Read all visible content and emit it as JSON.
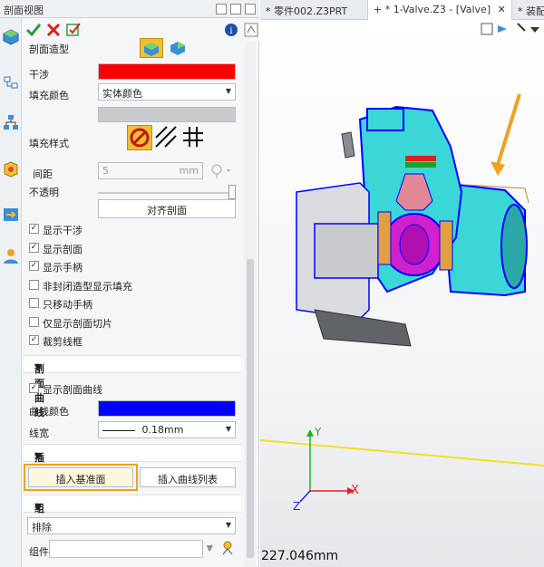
{
  "panel": {
    "title": "剖面视图",
    "section_shape_label": "剖面造型",
    "interference_label": "干涉",
    "interference_color": "#ff0000",
    "fill_color_label": "填充颜色",
    "fill_color_value": "实体颜色",
    "fill_style_label": "填充样式",
    "spacing_label": "间距",
    "spacing_value": "5",
    "spacing_unit": "mm",
    "opacity_label": "不透明",
    "align_button": "对齐剖面",
    "checkboxes": [
      {
        "label": "显示干涉",
        "checked": true
      },
      {
        "label": "显示剖面",
        "checked": true
      },
      {
        "label": "显示手柄",
        "checked": true
      },
      {
        "label": "非封闭造型显示填充",
        "checked": false
      },
      {
        "label": "只移动手柄",
        "checked": false
      },
      {
        "label": "仅显示剖面切片",
        "checked": false
      },
      {
        "label": "裁剪线框",
        "checked": true
      }
    ],
    "curve_section": {
      "title": "剖面曲线",
      "show_curve_label": "显示剖面曲线",
      "curve_color_label": "曲线颜色",
      "curve_color": "#0000ff",
      "line_width_label": "线宽",
      "line_width_value": "0.18mm"
    },
    "insert_section": {
      "title": "插入",
      "insert_plane": "插入基准面",
      "insert_curve_list": "插入曲线列表"
    },
    "component_section": {
      "title": "组件",
      "mode": "排除",
      "component_label": "组件"
    }
  },
  "tabs": [
    {
      "label": "* 零件002.Z3PRT",
      "active": false
    },
    {
      "label": "* 1-Valve.Z3 - [Valve]",
      "active": true
    },
    {
      "label": "* 装配0",
      "active": false
    }
  ],
  "viewport": {
    "readout": "227.046mm",
    "axis_x": "X",
    "axis_y": "Y",
    "axis_z": "Z"
  },
  "colors": {
    "accent_green": "#2a9d3a",
    "highlight_orange": "#f0a020"
  }
}
